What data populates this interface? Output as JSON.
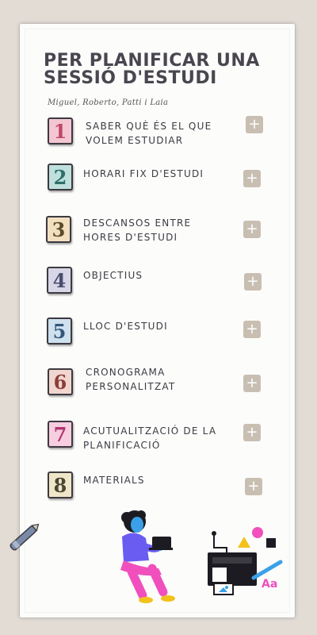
{
  "title": "PER PLANIFICAR UNA SESSIÓ D'ESTUDI",
  "authors": "Miguel, Roberto, Patti i Laia",
  "expand_symbol": "+",
  "design_glyph": "Aa",
  "items": [
    {
      "number": "1",
      "label": "SABER QUÈ ÉS EL QUE VOLEM ESTUDIAR",
      "color": "#f3c6d2",
      "text_color": "#c0476a"
    },
    {
      "number": "2",
      "label": "HORARI FIX D'ESTUDI",
      "color": "#bfe0dd",
      "text_color": "#2f6e6a"
    },
    {
      "number": "3",
      "label": "DESCANSOS ENTRE HORES D'ESTUDI",
      "color": "#f1dfc0",
      "text_color": "#5b4a2a"
    },
    {
      "number": "4",
      "label": "OBJECTIUS",
      "color": "#d6d6e6",
      "text_color": "#4b4c6e"
    },
    {
      "number": "5",
      "label": "LLOC D'ESTUDI",
      "color": "#cfe0ef",
      "text_color": "#35567a"
    },
    {
      "number": "6",
      "label": "CRONOGRAMA PERSONALITZAT",
      "color": "#f1d6cf",
      "text_color": "#8a3f3a"
    },
    {
      "number": "7",
      "label": "ACUTUALITZACIÓ DE LA PLANIFICACIÓ",
      "color": "#f7cde0",
      "text_color": "#b0366f"
    },
    {
      "number": "8",
      "label": "MATERIALS",
      "color": "#efe6c9",
      "text_color": "#4a4632"
    }
  ]
}
